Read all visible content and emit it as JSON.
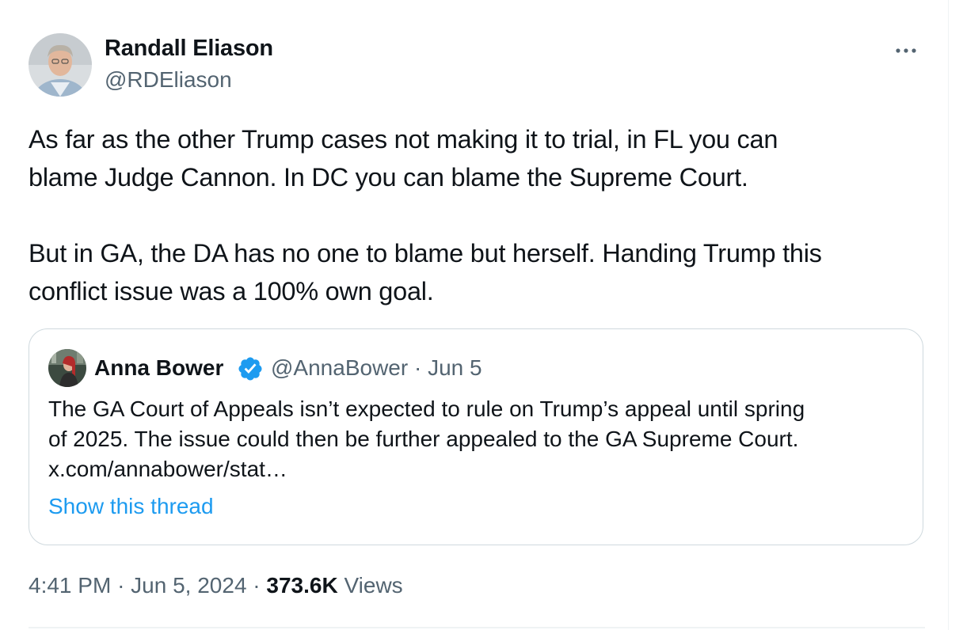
{
  "tweet": {
    "author_name": "Randall Eliason",
    "author_handle": "@RDEliason",
    "text_lines_p1": [
      "As far as the other Trump cases not making it to trial, in FL you can",
      "blame Judge Cannon. In DC you can blame the Supreme Court."
    ],
    "text_lines_p2": [
      "But in GA, the DA has no one to blame but herself. Handing Trump this",
      "conflict issue was a 100% own goal."
    ],
    "time": "4:41 PM",
    "date": "Jun 5, 2024",
    "separator": "·",
    "views_count": "373.6K",
    "views_label": "Views",
    "more_icon": "more-horizontal-icon"
  },
  "quoted": {
    "author_name": "Anna Bower",
    "verified_icon": "verified-badge-icon",
    "author_handle": "@AnnaBower",
    "separator": "·",
    "date": "Jun 5",
    "text_lines": [
      "The GA Court of Appeals isn’t expected to rule on Trump’s appeal until spring",
      "of 2025. The issue could then be further appealed to the GA Supreme Court.",
      "x.com/annabower/stat…"
    ],
    "show_thread": "Show this thread"
  },
  "colors": {
    "text": "#0f1419",
    "secondary": "#536471",
    "link": "#1d9bf0",
    "border": "#cfd9de"
  }
}
